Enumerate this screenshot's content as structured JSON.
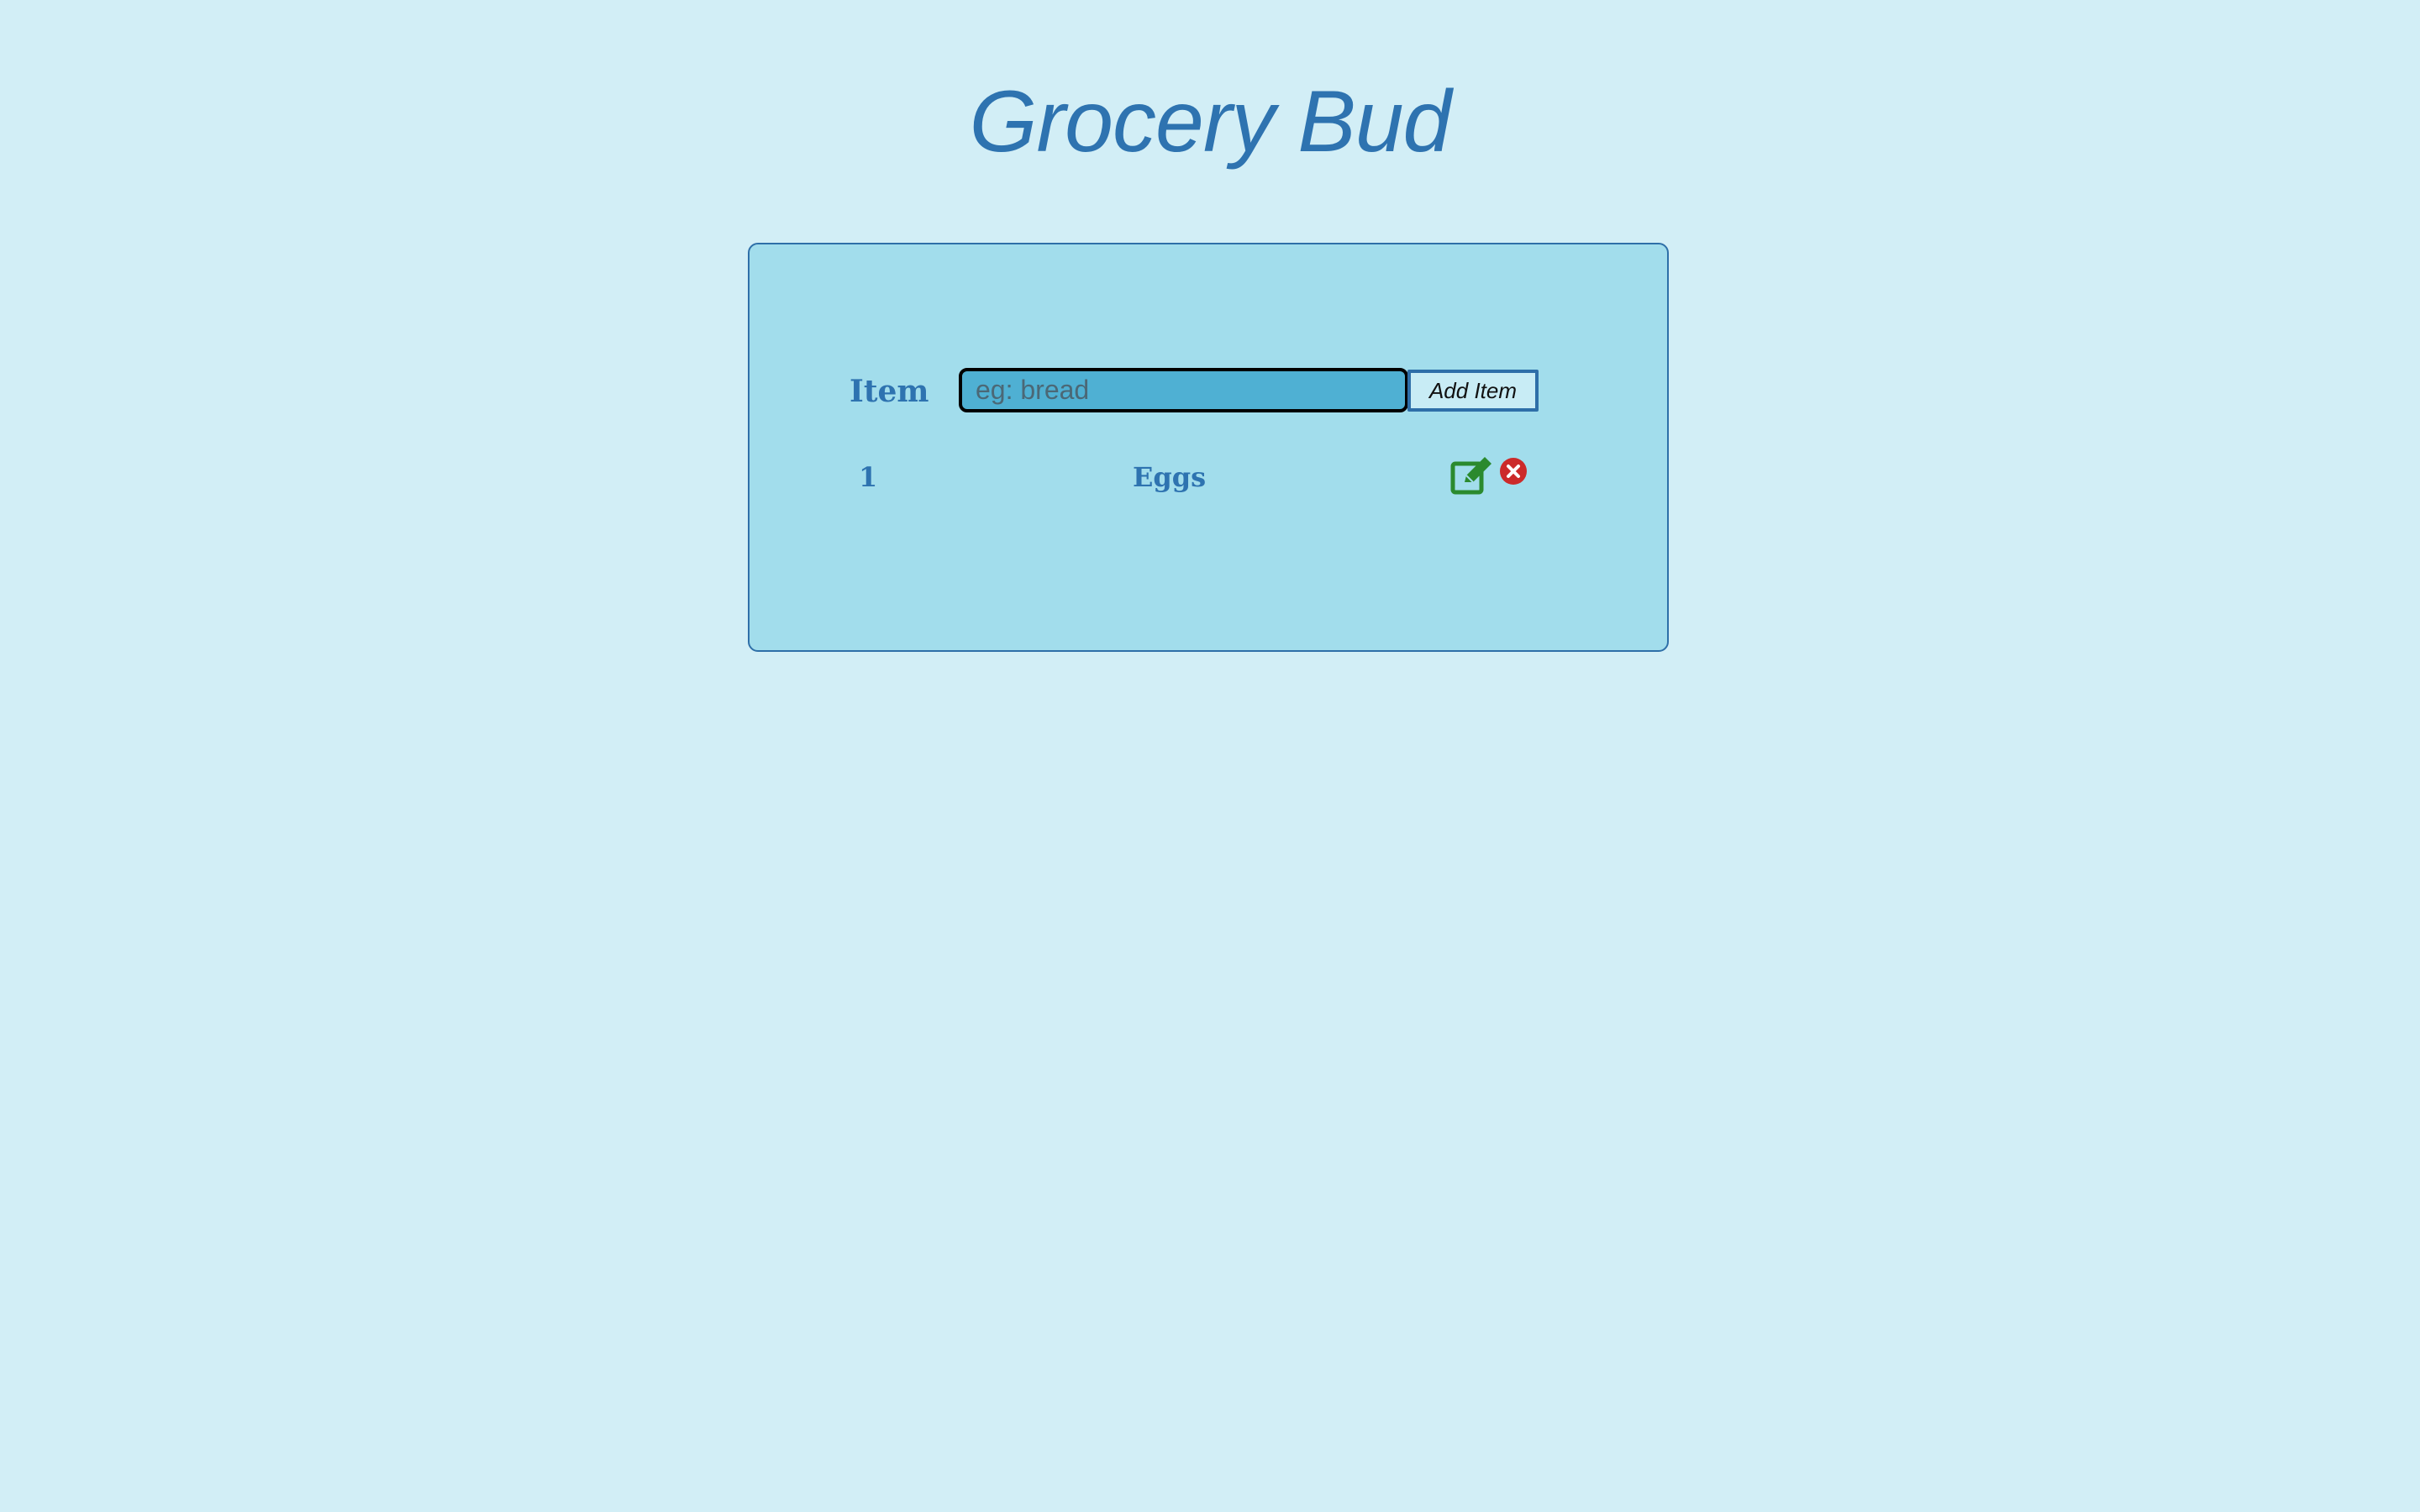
{
  "app": {
    "title": "Grocery Bud"
  },
  "form": {
    "label": "Item",
    "input_value": "",
    "input_placeholder": "eg: bread",
    "add_button_label": "Add Item"
  },
  "list": {
    "items": [
      {
        "index": "1",
        "name": "Eggs",
        "edit_icon": "edit-icon",
        "delete_icon": "delete-icon"
      }
    ]
  },
  "colors": {
    "background": "#d2eef6",
    "card": "#a2ddec",
    "accent": "#2e73b0",
    "input_bg": "#4fb0d3",
    "edit": "#2b8a2e",
    "delete": "#cc2a2a"
  }
}
